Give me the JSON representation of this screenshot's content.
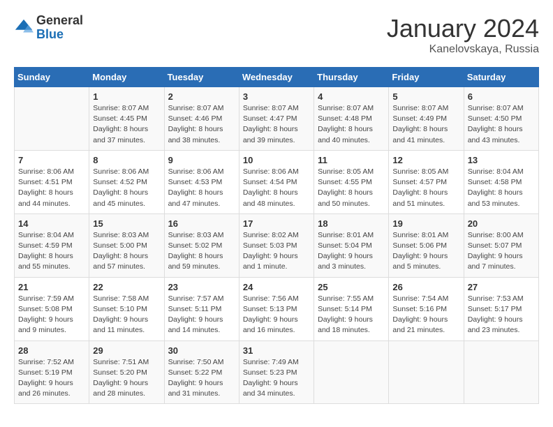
{
  "logo": {
    "general": "General",
    "blue": "Blue"
  },
  "title": "January 2024",
  "subtitle": "Kanelovskaya, Russia",
  "days_of_week": [
    "Sunday",
    "Monday",
    "Tuesday",
    "Wednesday",
    "Thursday",
    "Friday",
    "Saturday"
  ],
  "weeks": [
    [
      {
        "day": "",
        "info": ""
      },
      {
        "day": "1",
        "info": "Sunrise: 8:07 AM\nSunset: 4:45 PM\nDaylight: 8 hours\nand 37 minutes."
      },
      {
        "day": "2",
        "info": "Sunrise: 8:07 AM\nSunset: 4:46 PM\nDaylight: 8 hours\nand 38 minutes."
      },
      {
        "day": "3",
        "info": "Sunrise: 8:07 AM\nSunset: 4:47 PM\nDaylight: 8 hours\nand 39 minutes."
      },
      {
        "day": "4",
        "info": "Sunrise: 8:07 AM\nSunset: 4:48 PM\nDaylight: 8 hours\nand 40 minutes."
      },
      {
        "day": "5",
        "info": "Sunrise: 8:07 AM\nSunset: 4:49 PM\nDaylight: 8 hours\nand 41 minutes."
      },
      {
        "day": "6",
        "info": "Sunrise: 8:07 AM\nSunset: 4:50 PM\nDaylight: 8 hours\nand 43 minutes."
      }
    ],
    [
      {
        "day": "7",
        "info": "Sunrise: 8:06 AM\nSunset: 4:51 PM\nDaylight: 8 hours\nand 44 minutes."
      },
      {
        "day": "8",
        "info": "Sunrise: 8:06 AM\nSunset: 4:52 PM\nDaylight: 8 hours\nand 45 minutes."
      },
      {
        "day": "9",
        "info": "Sunrise: 8:06 AM\nSunset: 4:53 PM\nDaylight: 8 hours\nand 47 minutes."
      },
      {
        "day": "10",
        "info": "Sunrise: 8:06 AM\nSunset: 4:54 PM\nDaylight: 8 hours\nand 48 minutes."
      },
      {
        "day": "11",
        "info": "Sunrise: 8:05 AM\nSunset: 4:55 PM\nDaylight: 8 hours\nand 50 minutes."
      },
      {
        "day": "12",
        "info": "Sunrise: 8:05 AM\nSunset: 4:57 PM\nDaylight: 8 hours\nand 51 minutes."
      },
      {
        "day": "13",
        "info": "Sunrise: 8:04 AM\nSunset: 4:58 PM\nDaylight: 8 hours\nand 53 minutes."
      }
    ],
    [
      {
        "day": "14",
        "info": "Sunrise: 8:04 AM\nSunset: 4:59 PM\nDaylight: 8 hours\nand 55 minutes."
      },
      {
        "day": "15",
        "info": "Sunrise: 8:03 AM\nSunset: 5:00 PM\nDaylight: 8 hours\nand 57 minutes."
      },
      {
        "day": "16",
        "info": "Sunrise: 8:03 AM\nSunset: 5:02 PM\nDaylight: 8 hours\nand 59 minutes."
      },
      {
        "day": "17",
        "info": "Sunrise: 8:02 AM\nSunset: 5:03 PM\nDaylight: 9 hours\nand 1 minute."
      },
      {
        "day": "18",
        "info": "Sunrise: 8:01 AM\nSunset: 5:04 PM\nDaylight: 9 hours\nand 3 minutes."
      },
      {
        "day": "19",
        "info": "Sunrise: 8:01 AM\nSunset: 5:06 PM\nDaylight: 9 hours\nand 5 minutes."
      },
      {
        "day": "20",
        "info": "Sunrise: 8:00 AM\nSunset: 5:07 PM\nDaylight: 9 hours\nand 7 minutes."
      }
    ],
    [
      {
        "day": "21",
        "info": "Sunrise: 7:59 AM\nSunset: 5:08 PM\nDaylight: 9 hours\nand 9 minutes."
      },
      {
        "day": "22",
        "info": "Sunrise: 7:58 AM\nSunset: 5:10 PM\nDaylight: 9 hours\nand 11 minutes."
      },
      {
        "day": "23",
        "info": "Sunrise: 7:57 AM\nSunset: 5:11 PM\nDaylight: 9 hours\nand 14 minutes."
      },
      {
        "day": "24",
        "info": "Sunrise: 7:56 AM\nSunset: 5:13 PM\nDaylight: 9 hours\nand 16 minutes."
      },
      {
        "day": "25",
        "info": "Sunrise: 7:55 AM\nSunset: 5:14 PM\nDaylight: 9 hours\nand 18 minutes."
      },
      {
        "day": "26",
        "info": "Sunrise: 7:54 AM\nSunset: 5:16 PM\nDaylight: 9 hours\nand 21 minutes."
      },
      {
        "day": "27",
        "info": "Sunrise: 7:53 AM\nSunset: 5:17 PM\nDaylight: 9 hours\nand 23 minutes."
      }
    ],
    [
      {
        "day": "28",
        "info": "Sunrise: 7:52 AM\nSunset: 5:19 PM\nDaylight: 9 hours\nand 26 minutes."
      },
      {
        "day": "29",
        "info": "Sunrise: 7:51 AM\nSunset: 5:20 PM\nDaylight: 9 hours\nand 28 minutes."
      },
      {
        "day": "30",
        "info": "Sunrise: 7:50 AM\nSunset: 5:22 PM\nDaylight: 9 hours\nand 31 minutes."
      },
      {
        "day": "31",
        "info": "Sunrise: 7:49 AM\nSunset: 5:23 PM\nDaylight: 9 hours\nand 34 minutes."
      },
      {
        "day": "",
        "info": ""
      },
      {
        "day": "",
        "info": ""
      },
      {
        "day": "",
        "info": ""
      }
    ]
  ]
}
